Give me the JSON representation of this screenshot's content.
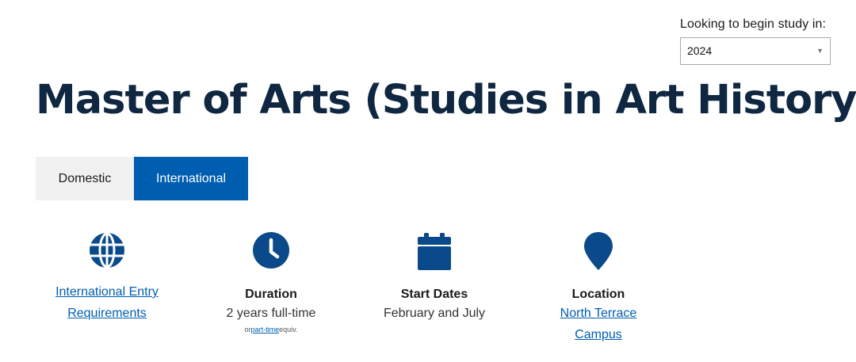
{
  "study_select": {
    "label": "Looking to begin study in:",
    "selected": "2024"
  },
  "page_title": "Master of Arts (Studies in Art History)",
  "tabs": [
    {
      "label": "Domestic",
      "active": false
    },
    {
      "label": "International",
      "active": true
    }
  ],
  "facts": {
    "entry": {
      "icon": "globe-icon",
      "link_line1": "International Entry",
      "link_line2": "Requirements"
    },
    "duration": {
      "icon": "clock-icon",
      "title": "Duration",
      "value": "2 years full-time",
      "note_prefix": "or",
      "note_link": "part-time",
      "note_suffix": "equiv."
    },
    "start": {
      "icon": "calendar-icon",
      "title": "Start Dates",
      "value": "February and July"
    },
    "location": {
      "icon": "map-pin-icon",
      "title": "Location",
      "link_line1": "North Terrace",
      "link_line2": "Campus"
    }
  },
  "colors": {
    "title": "#0f2740",
    "accent": "#005eb0",
    "icon": "#0b4a8a",
    "tab_inactive_bg": "#f1f1f1"
  }
}
